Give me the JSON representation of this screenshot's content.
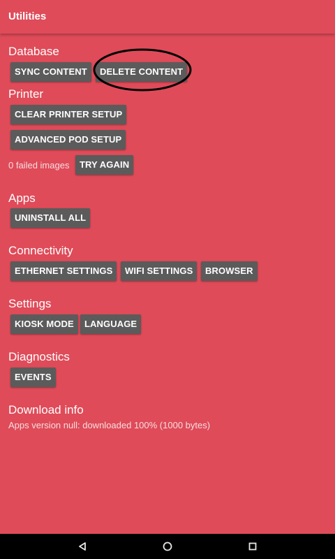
{
  "appbar": {
    "title": "Utilities"
  },
  "sections": {
    "database": {
      "title": "Database",
      "sync_content": "SYNC CONTENT",
      "delete_content": "DELETE CONTENT"
    },
    "printer": {
      "title": "Printer",
      "clear_printer_setup": "CLEAR PRINTER SETUP",
      "advanced_pod_setup": "ADVANCED POD SETUP",
      "failed_images_text": "0 failed images",
      "try_again": "TRY AGAIN"
    },
    "apps": {
      "title": "Apps",
      "uninstall_all": "UNINSTALL ALL"
    },
    "connectivity": {
      "title": "Connectivity",
      "ethernet_settings": "ETHERNET SETTINGS",
      "wifi_settings": "WIFI SETTINGS",
      "browser": "BROWSER"
    },
    "settings": {
      "title": "Settings",
      "kiosk_mode": "KIOSK MODE",
      "language": "LANGUAGE"
    },
    "diagnostics": {
      "title": "Diagnostics",
      "events": "EVENTS"
    },
    "download_info": {
      "title": "Download info",
      "status": "Apps version null: downloaded 100% (1000 bytes)"
    }
  },
  "navbar": {
    "back_icon": "back-triangle-icon",
    "home_icon": "home-circle-icon",
    "recents_icon": "recents-square-icon"
  },
  "colors": {
    "background": "#df4b59",
    "button": "#5b5b5b",
    "navbar": "#000000"
  }
}
